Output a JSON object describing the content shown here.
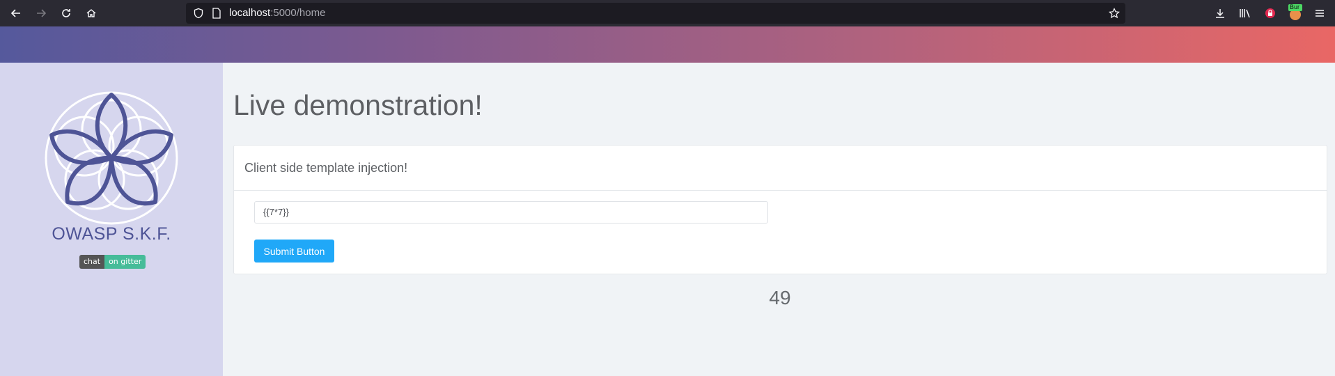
{
  "browser": {
    "url_host": "localhost",
    "url_path": ":5000/home",
    "burp_badge": "Bur"
  },
  "sidebar": {
    "brand": "OWASP S.K.F.",
    "badge_left": "chat",
    "badge_right": "on gitter"
  },
  "main": {
    "title": "Live demonstration!",
    "card_header": "Client side template injection!",
    "input_value": "{{7*7}}",
    "submit_label": "Submit Button",
    "result": "49"
  },
  "colors": {
    "banner_start": "#55599c",
    "banner_end": "#e96765",
    "sidebar_bg": "#d6d6ee",
    "brand": "#4e5496",
    "button": "#20a8f8"
  }
}
